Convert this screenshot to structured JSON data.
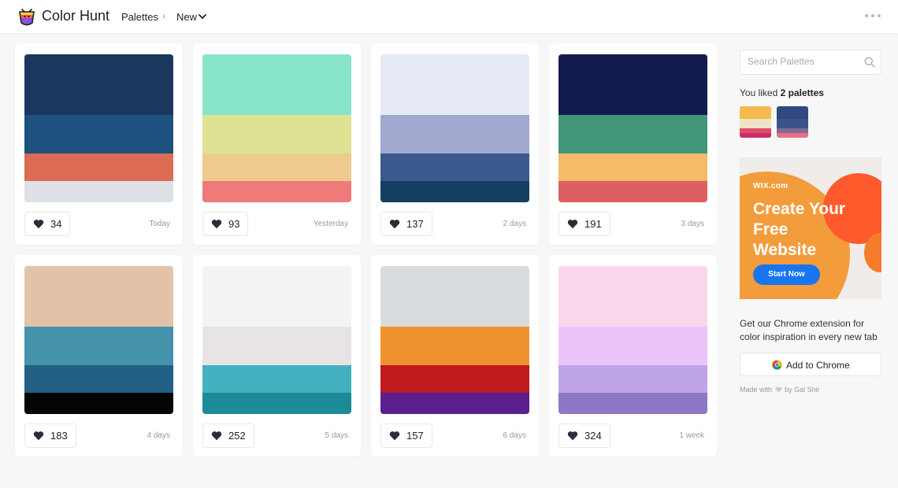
{
  "header": {
    "brand": "Color Hunt",
    "nav_palettes": "Palettes",
    "nav_separator": "›",
    "nav_current": "New",
    "logo_icon": "color-hunt-logo-icon",
    "chevron_icon": "chevron-down-icon",
    "menu_icon": "more-dots-icon"
  },
  "palettes": [
    {
      "colors": [
        "#1c375e",
        "#1d5180",
        "#db6b52",
        "#dde1e6"
      ],
      "likes": "34",
      "date": "Today"
    },
    {
      "colors": [
        "#88e5cc",
        "#dfe293",
        "#efca8e",
        "#ee7a7a"
      ],
      "likes": "93",
      "date": "Yesterday"
    },
    {
      "colors": [
        "#e6eaf5",
        "#a2a9d0",
        "#3a5a8d",
        "#143f63"
      ],
      "likes": "137",
      "date": "2 days"
    },
    {
      "colors": [
        "#141b4d",
        "#42967a",
        "#f6bb66",
        "#dc5f61"
      ],
      "likes": "191",
      "date": "3 days"
    },
    {
      "colors": [
        "#e2c3a9",
        "#4593ab",
        "#236085",
        "#050505"
      ],
      "likes": "183",
      "date": "4 days"
    },
    {
      "colors": [
        "#f3f3f4",
        "#e9e4e4",
        "#43b1bf",
        "#1b8b97"
      ],
      "likes": "252",
      "date": "5 days"
    },
    {
      "colors": [
        "#d8dcdf",
        "#f0922f",
        "#c0191e",
        "#5b1f8e"
      ],
      "likes": "157",
      "date": "6 days"
    },
    {
      "colors": [
        "#fad6ea",
        "#ebc5fa",
        "#bea4e8",
        "#8d78c6"
      ],
      "likes": "324",
      "date": "1 week"
    }
  ],
  "sidebar": {
    "search_placeholder": "Search Palettes",
    "search_icon": "search-icon",
    "liked_prefix": "You liked ",
    "liked_count": "2 palettes",
    "liked_palettes": [
      [
        "#f6bb4e",
        "#efe3c7",
        "#dc4f67",
        "#cc2c68"
      ],
      [
        "#2f4a80",
        "#3c528a",
        "#7f6a94",
        "#e96f86"
      ]
    ],
    "ad": {
      "brand": "WIX.com",
      "title": "Create Your Free Website",
      "cta": "Start Now"
    },
    "extension_text": "Get our Chrome extension for color inspiration in every new tab",
    "chrome_button_label": "Add to Chrome",
    "chrome_icon": "chrome-icon",
    "footer_prefix": "Made with",
    "footer_suffix": "by Gal Shir",
    "footer_heart_icon": "heart-icon"
  },
  "colors": {
    "heart": "#2b2d3a",
    "footer_heart": "#c8cbd1",
    "accent_cta": "#1875f0"
  }
}
